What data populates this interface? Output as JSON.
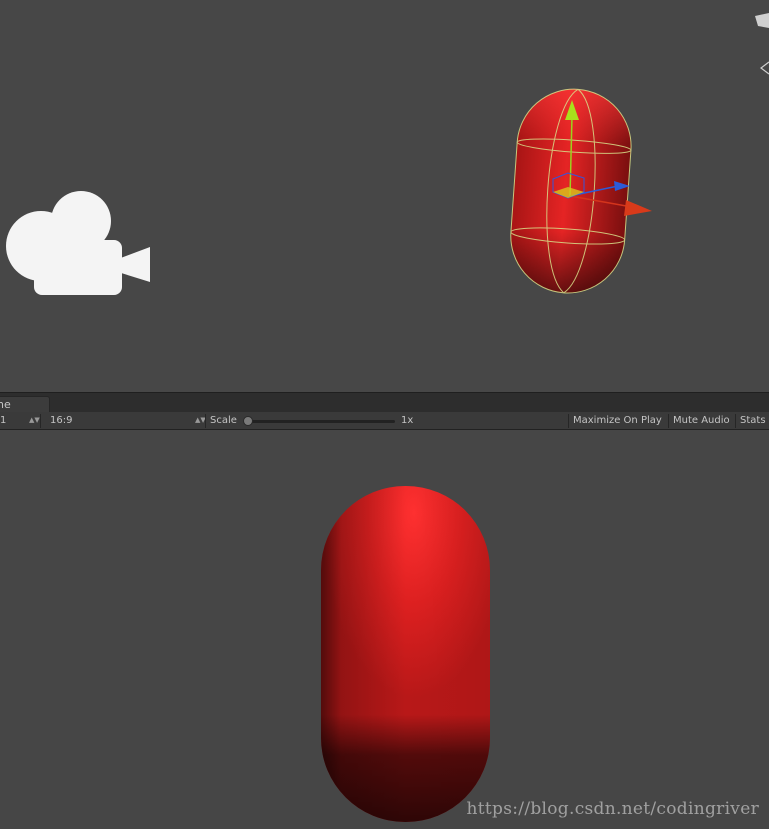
{
  "game_tab": {
    "label": "ne"
  },
  "toolbar": {
    "display_value": "1",
    "aspect_value": "16:9",
    "scale_label": "Scale",
    "scale_value": "1x",
    "maximize_on_play": "Maximize On Play",
    "mute_audio": "Mute Audio",
    "stats": "Stats"
  },
  "watermark": "https://blog.csdn.net/codingriver",
  "colors": {
    "capsule_red": "#e02020",
    "gizmo_y_axis": "#9ad31d",
    "gizmo_x_axis": "#d4341c",
    "gizmo_z_axis": "#2c5bd8",
    "collider_outline": "#d8e08a"
  }
}
